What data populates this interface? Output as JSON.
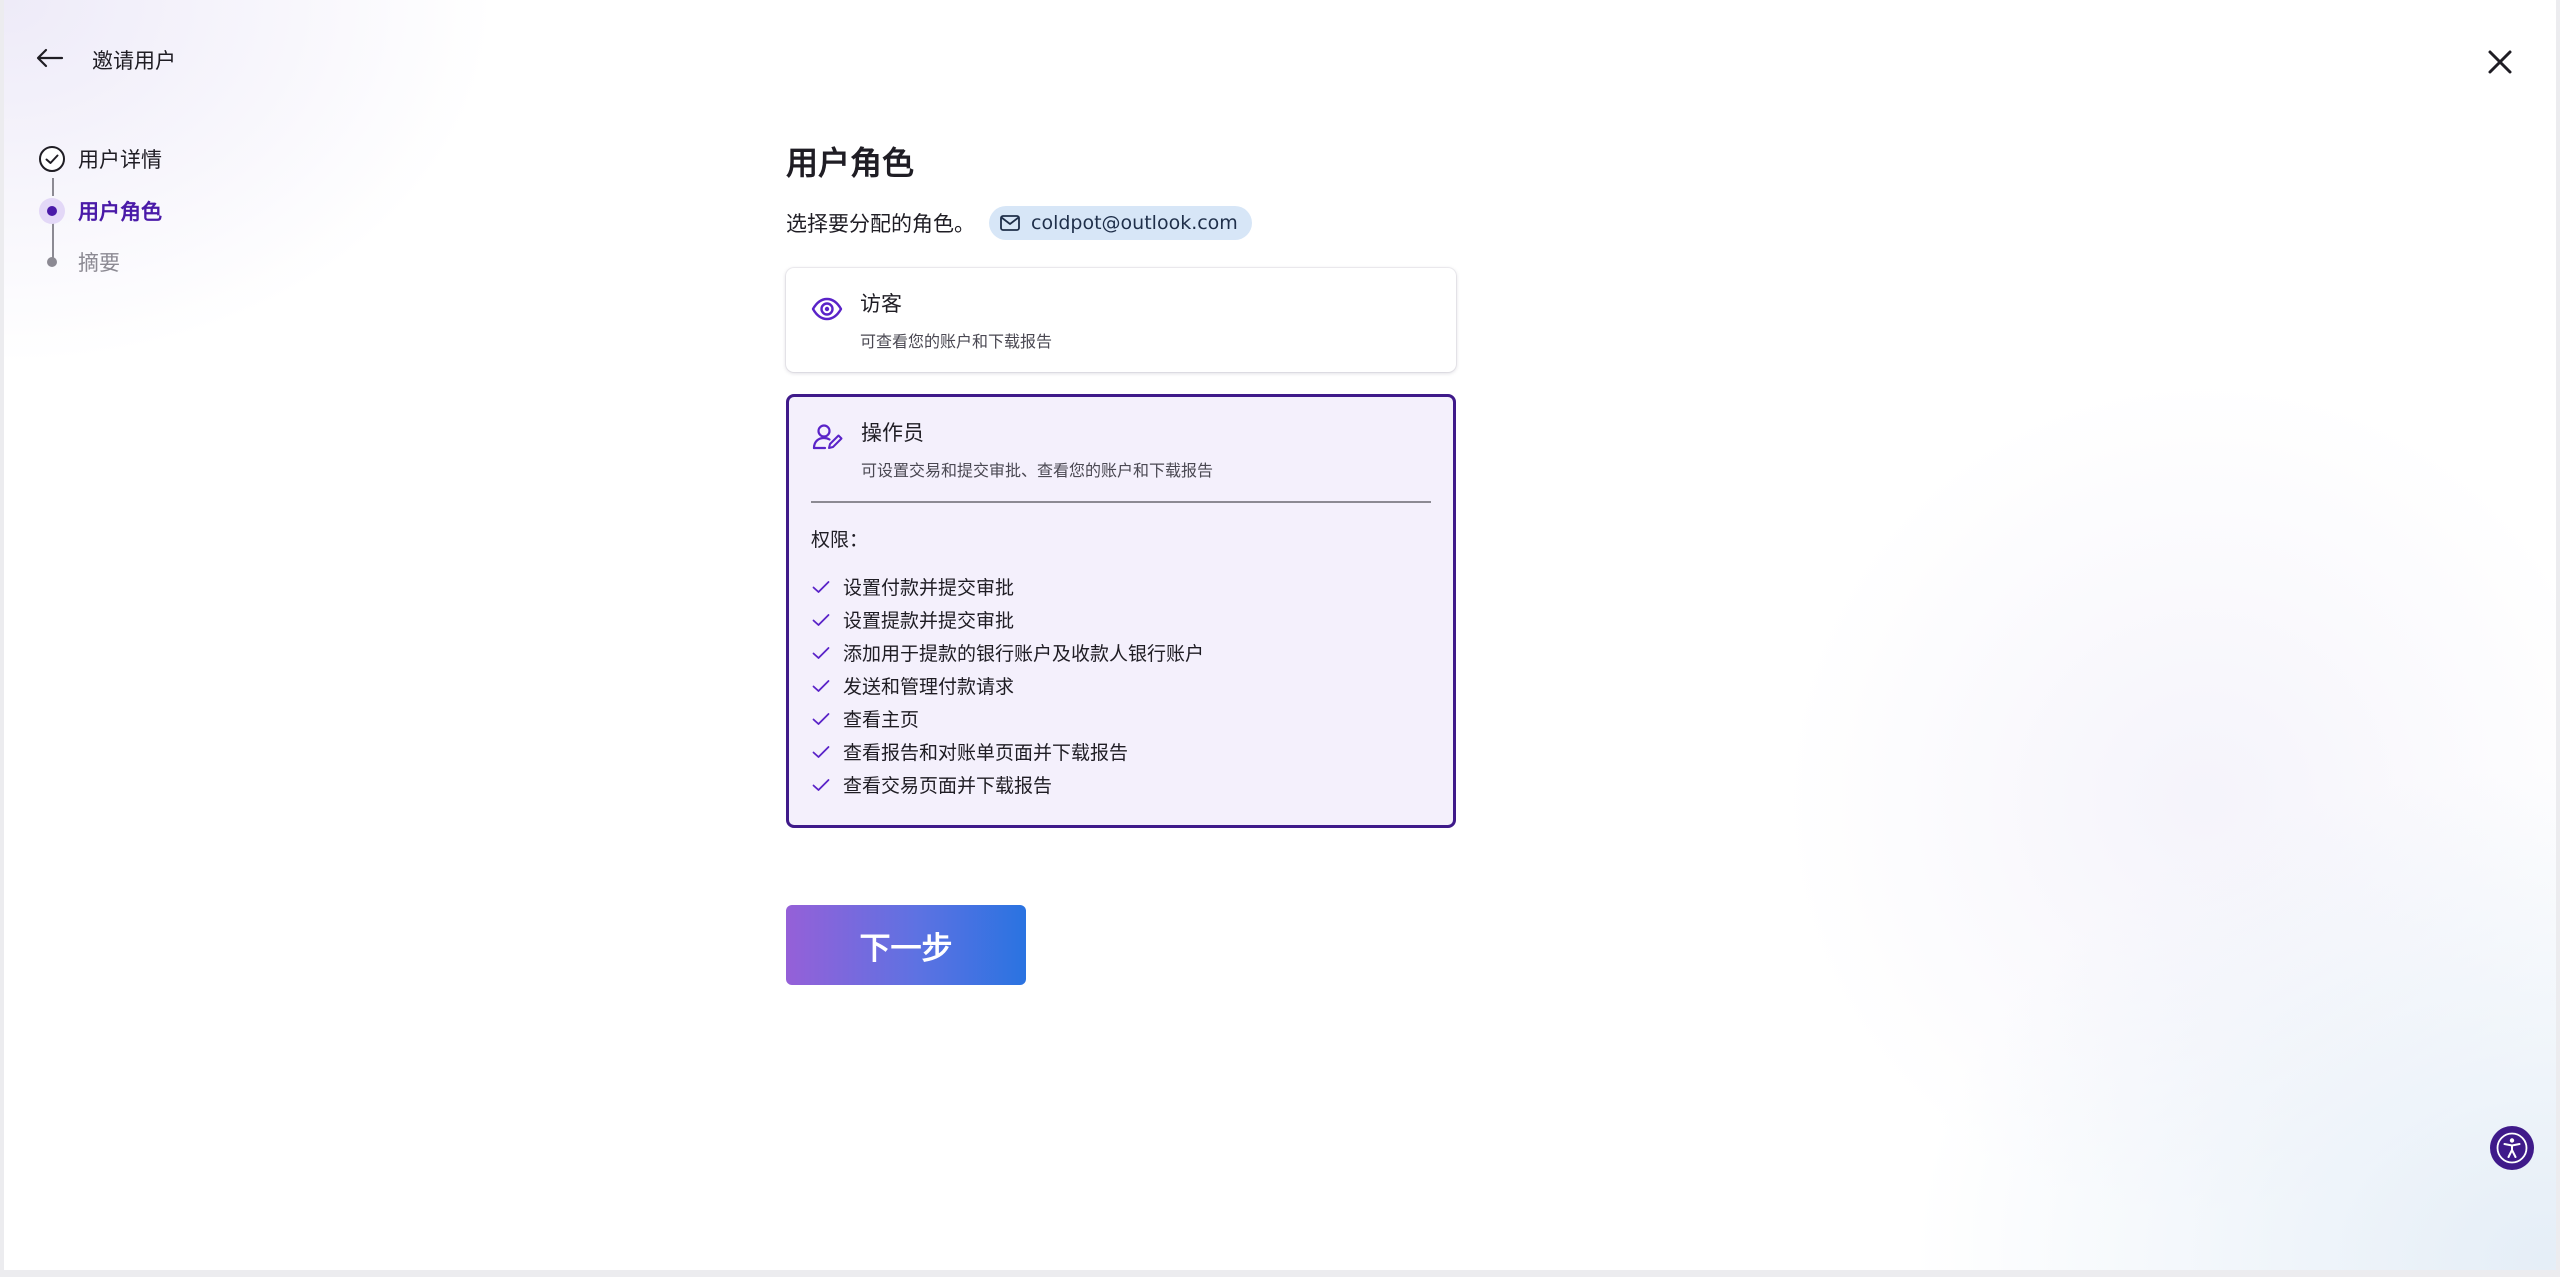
{
  "header": {
    "title": "邀请用户"
  },
  "stepper": {
    "steps": [
      {
        "label": "用户详情",
        "state": "done"
      },
      {
        "label": "用户角色",
        "state": "current"
      },
      {
        "label": "摘要",
        "state": "pending"
      }
    ]
  },
  "main": {
    "title": "用户角色",
    "subtitle": "选择要分配的角色。",
    "email": "coldpot@outlook.com",
    "roles": [
      {
        "name": "访客",
        "description": "可查看您的账户和下载报告",
        "icon": "eye-icon",
        "selected": false
      },
      {
        "name": "操作员",
        "description": "可设置交易和提交审批、查看您的账户和下载报告",
        "icon": "user-edit-icon",
        "selected": true,
        "permissions_title": "权限：",
        "permissions": [
          "设置付款并提交审批",
          "设置提款并提交审批",
          "添加用于提款的银行账户及收款人银行账户",
          "发送和管理付款请求",
          "查看主页",
          "查看报告和对账单页面并下载报告",
          "查看交易页面并下载报告"
        ]
      }
    ]
  },
  "actions": {
    "next_label": "下一步"
  },
  "colors": {
    "accent": "#4a1aa8",
    "selected_border": "#3f1a8a",
    "selected_bg": "#f4f0fc",
    "email_chip_bg": "#d7e6f7",
    "button_gradient_start": "#9560d8",
    "button_gradient_end": "#2a73e1"
  }
}
